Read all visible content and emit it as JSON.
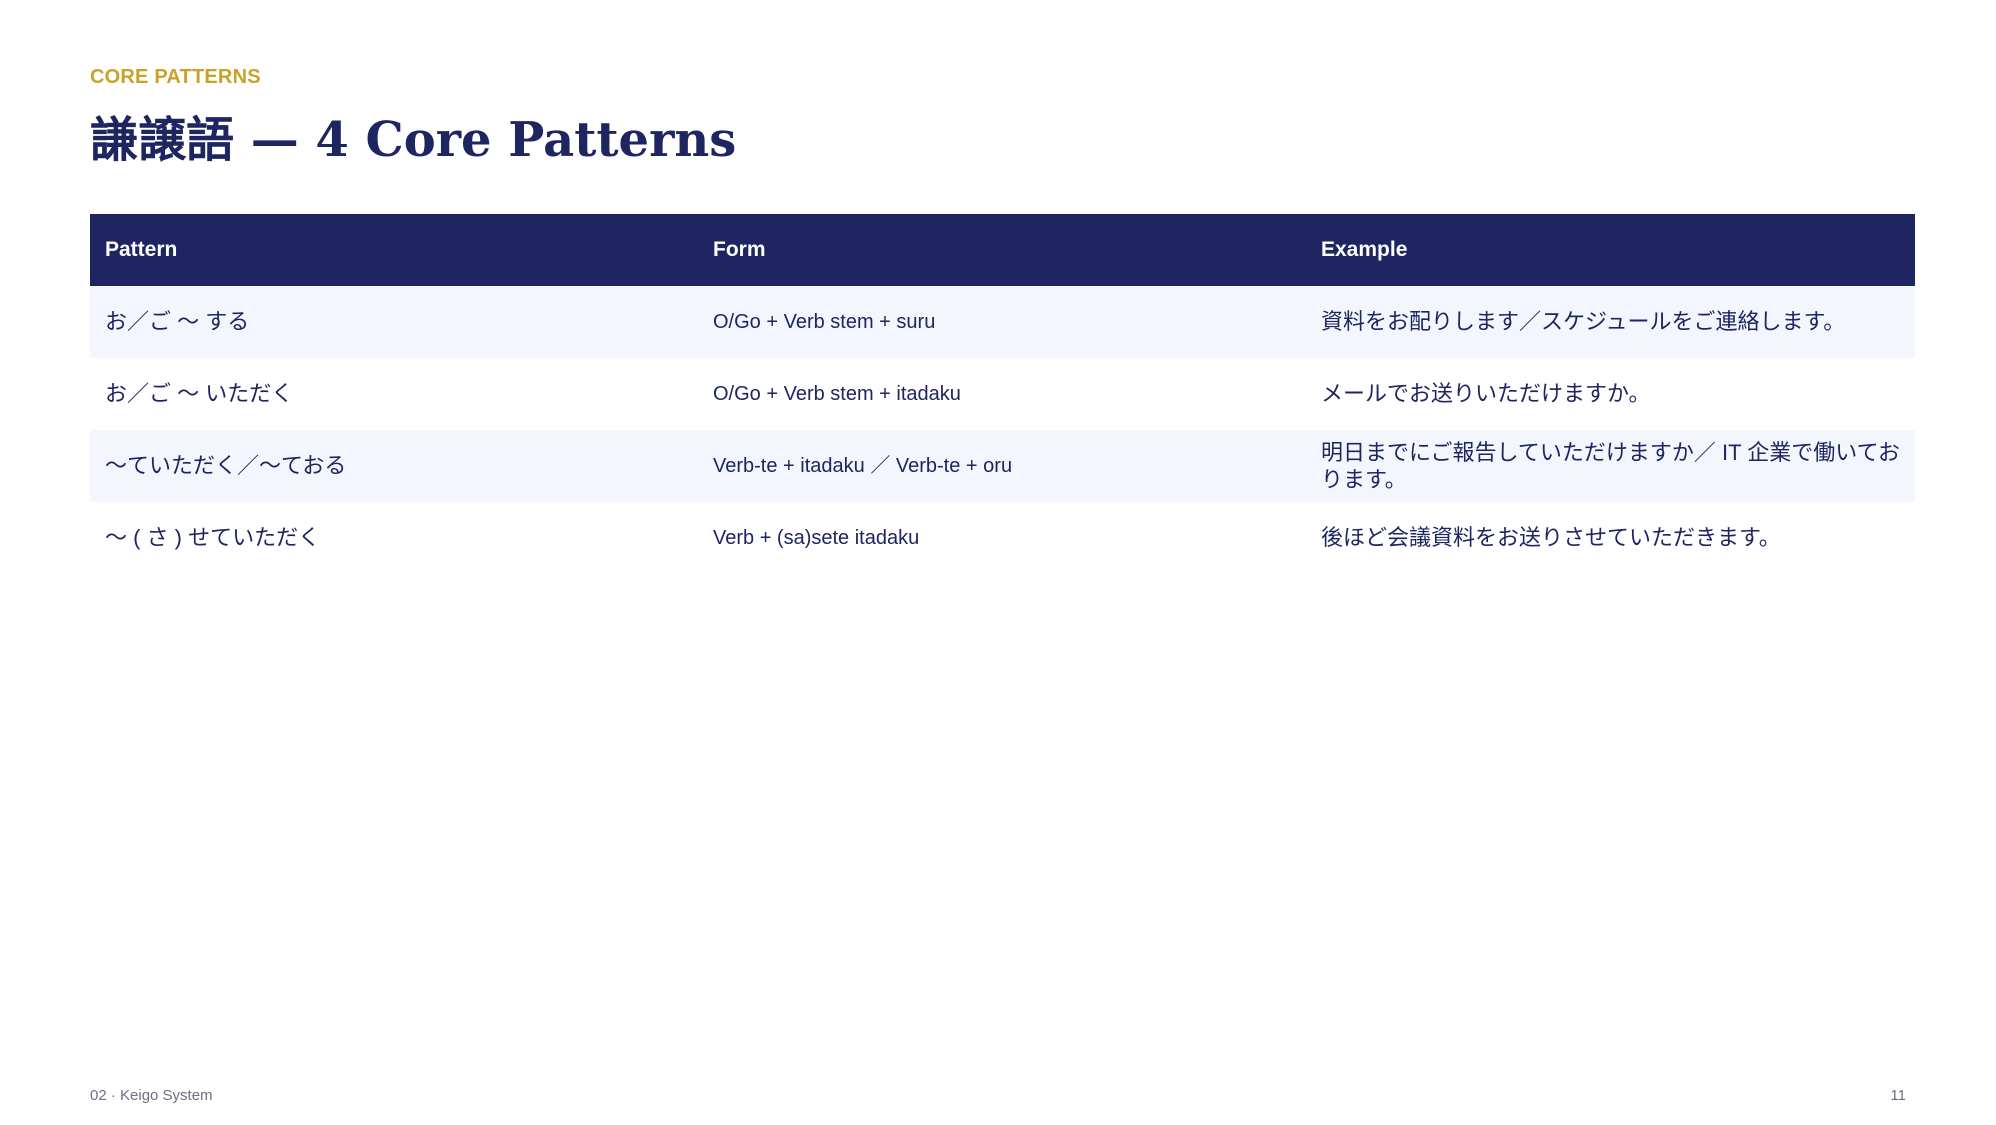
{
  "eyebrow": "CORE PATTERNS",
  "title": "謙譲語 —  4 Core Patterns",
  "table": {
    "headers": [
      "Pattern",
      "Form",
      "Example"
    ],
    "rows": [
      {
        "pattern": "お／ご ～ する",
        "form": "O/Go + Verb stem + suru",
        "example": "資料をお配りします／スケジュールをご連絡します。"
      },
      {
        "pattern": "お／ご ～ いただく",
        "form": "O/Go + Verb stem + itadaku",
        "example": "メールでお送りいただけますか。"
      },
      {
        "pattern": "〜ていただく／〜ておる",
        "form": "Verb-te + itadaku ／ Verb-te + oru",
        "example": "明日までにご報告していただけますか／ IT 企業で働いております。"
      },
      {
        "pattern": "〜 ( さ ) せていただく",
        "form": "Verb + (sa)sete itadaku",
        "example": "後ほど会議資料をお送りさせていただきます。"
      }
    ]
  },
  "footer": {
    "section": "02 · Keigo System",
    "page_number": "11"
  },
  "colors": {
    "accent": "#c9a227",
    "navy": "#1e2560",
    "row_shade": "#f3f7fd"
  }
}
